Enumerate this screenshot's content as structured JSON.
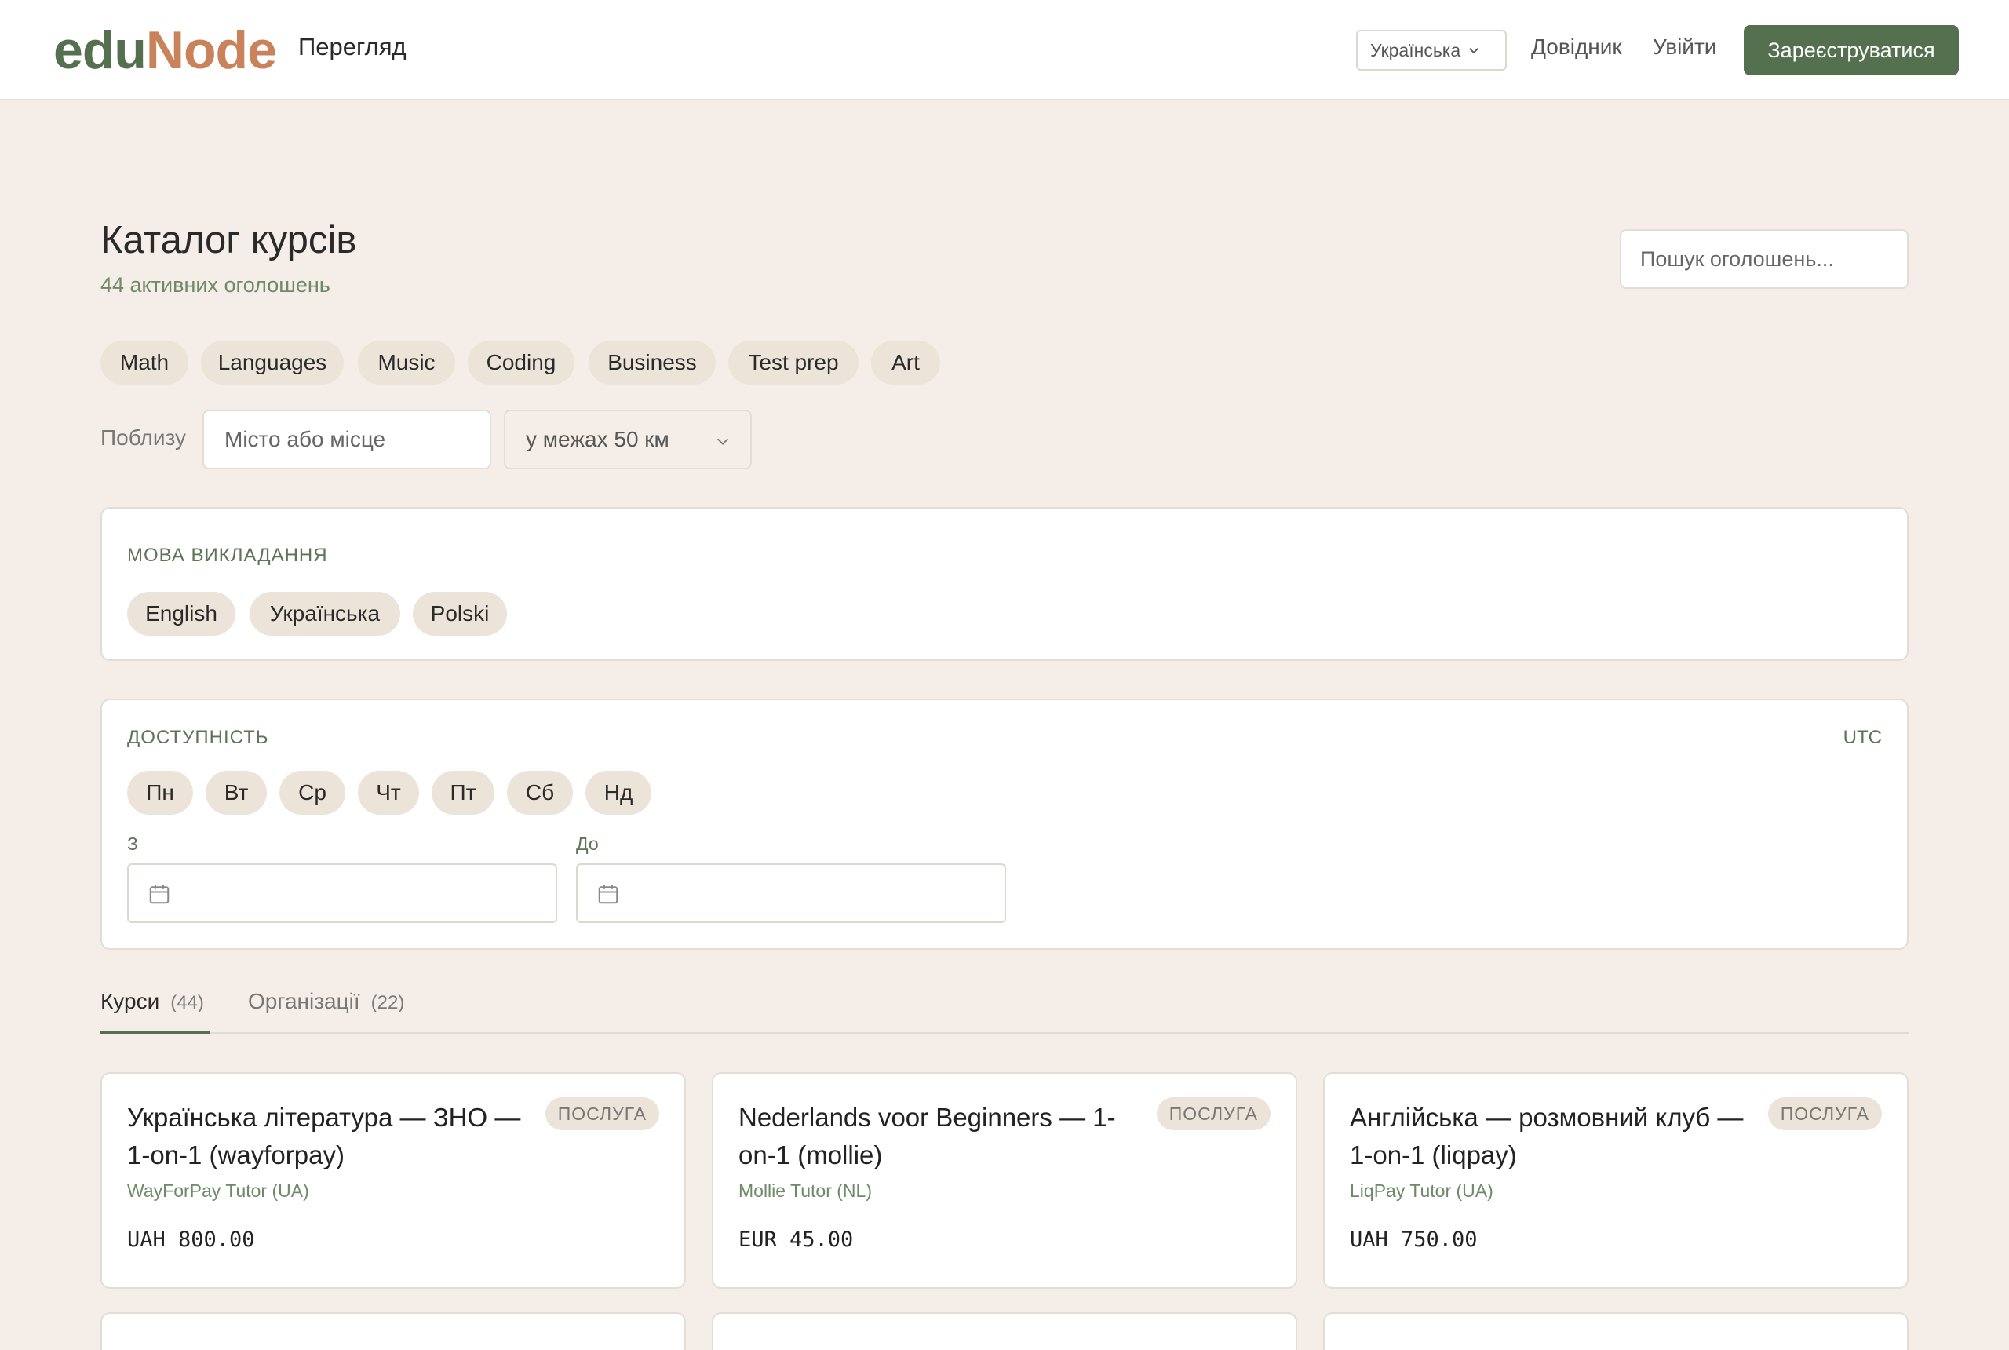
{
  "header": {
    "logo_edu": "edu",
    "logo_node": "Node",
    "nav_title": "Перегляд",
    "language": "Українська",
    "help_link": "Довідник",
    "login_link": "Увійти",
    "signup_button": "Зареєструватися"
  },
  "catalog": {
    "title": "Каталог курсів",
    "subtitle": "44 активних оголошень",
    "search_placeholder": "Пошук оголошень..."
  },
  "categories": [
    "Math",
    "Languages",
    "Music",
    "Coding",
    "Business",
    "Test prep",
    "Art"
  ],
  "nearby": {
    "label": "Поблизу",
    "location_placeholder": "Місто або місце",
    "radius": "у межах 50 км"
  },
  "language_filter": {
    "label": "МОВА ВИКЛАДАННЯ",
    "options": [
      "English",
      "Українська",
      "Polski"
    ]
  },
  "availability": {
    "label": "ДОСТУПНІСТЬ",
    "timezone": "UTC",
    "days": [
      "Пн",
      "Вт",
      "Ср",
      "Чт",
      "Пт",
      "Сб",
      "Нд"
    ],
    "from_label": "З",
    "to_label": "До"
  },
  "tabs": [
    {
      "label": "Курси",
      "count": "(44)"
    },
    {
      "label": "Організації",
      "count": "(22)"
    }
  ],
  "cards": [
    {
      "title": "Українська література — ЗНО — 1-on-1 (wayforpay)",
      "badge": "ПОСЛУГА",
      "org": "WayForPay Tutor (UA)",
      "price": "UAH 800.00"
    },
    {
      "title": "Nederlands voor Beginners — 1-on-1 (mollie)",
      "badge": "ПОСЛУГА",
      "org": "Mollie Tutor (NL)",
      "price": "EUR 45.00"
    },
    {
      "title": "Англійська — розмовний клуб — 1-on-1 (liqpay)",
      "badge": "ПОСЛУГА",
      "org": "LiqPay Tutor (UA)",
      "price": "UAH 750.00"
    }
  ],
  "colors": {
    "brand_green": "#54704f",
    "brand_orange": "#c9825a",
    "background": "#f5eee8"
  }
}
